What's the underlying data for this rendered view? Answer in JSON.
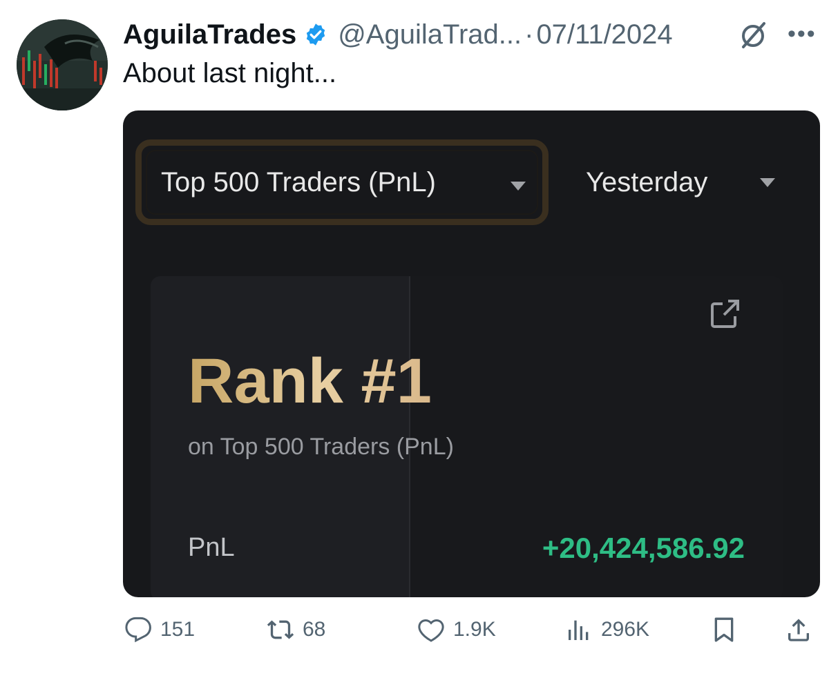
{
  "tweet": {
    "author_name": "AguilaTrades",
    "handle": "@AguilaTrad...",
    "separator": "·",
    "date": "07/11/2024",
    "text": "About last night..."
  },
  "media": {
    "dropdown_label": "Top 500 Traders (PnL)",
    "range_label": "Yesterday",
    "rank_title": "Rank #1",
    "rank_subtitle": "on Top 500 Traders (PnL)",
    "pnl_label": "PnL",
    "pnl_value": "+20,424,586.92",
    "pnl_color": "#2ebd85",
    "accent_gold": "#c7a665"
  },
  "actions": {
    "replies": "151",
    "reposts": "68",
    "likes": "1.9K",
    "views": "296K"
  },
  "colors": {
    "text_primary": "#0f1419",
    "text_secondary": "#536471",
    "verified_blue": "#1d9bf0",
    "media_bg": "#17181b"
  },
  "icons": [
    "verified-icon",
    "grok-icon",
    "more-icon",
    "caret-down-icon",
    "share-external-icon",
    "reply-icon",
    "repost-icon",
    "like-icon",
    "views-icon",
    "bookmark-icon",
    "share-icon"
  ]
}
